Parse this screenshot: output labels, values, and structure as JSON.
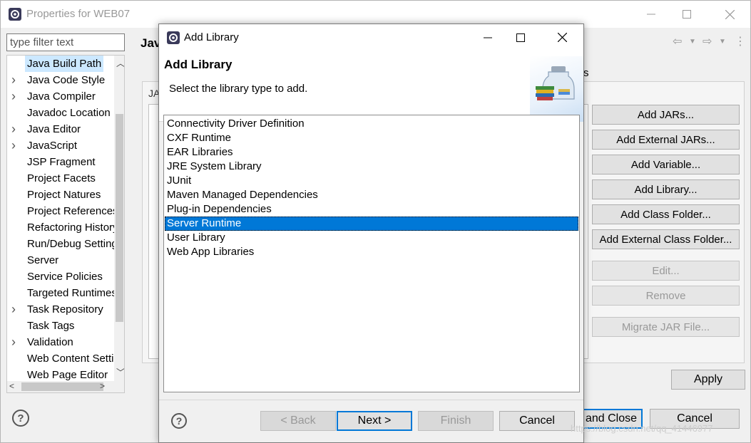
{
  "outer_window": {
    "title": "Properties for WEB07",
    "filter_placeholder": "type filter text",
    "page_heading": "Jav",
    "tree_items": [
      {
        "label": "Java Build Path",
        "has_arrow": false,
        "selected": true
      },
      {
        "label": "Java Code Style",
        "has_arrow": true,
        "selected": false
      },
      {
        "label": "Java Compiler",
        "has_arrow": true,
        "selected": false
      },
      {
        "label": "Javadoc Location",
        "has_arrow": false,
        "selected": false
      },
      {
        "label": "Java Editor",
        "has_arrow": true,
        "selected": false
      },
      {
        "label": "JavaScript",
        "has_arrow": true,
        "selected": false
      },
      {
        "label": "JSP Fragment",
        "has_arrow": false,
        "selected": false
      },
      {
        "label": "Project Facets",
        "has_arrow": false,
        "selected": false
      },
      {
        "label": "Project Natures",
        "has_arrow": false,
        "selected": false
      },
      {
        "label": "Project References",
        "has_arrow": false,
        "selected": false
      },
      {
        "label": "Refactoring History",
        "has_arrow": false,
        "selected": false
      },
      {
        "label": "Run/Debug Settings",
        "has_arrow": false,
        "selected": false
      },
      {
        "label": "Server",
        "has_arrow": false,
        "selected": false
      },
      {
        "label": "Service Policies",
        "has_arrow": false,
        "selected": false
      },
      {
        "label": "Targeted Runtimes",
        "has_arrow": false,
        "selected": false
      },
      {
        "label": "Task Repository",
        "has_arrow": true,
        "selected": false
      },
      {
        "label": "Task Tags",
        "has_arrow": false,
        "selected": false
      },
      {
        "label": "Validation",
        "has_arrow": true,
        "selected": false
      },
      {
        "label": "Web Content Settings",
        "has_arrow": false,
        "selected": false
      },
      {
        "label": "Web Page Editor",
        "has_arrow": false,
        "selected": false
      }
    ],
    "side_buttons": [
      {
        "label": "Add JARs...",
        "enabled": true
      },
      {
        "label": "Add External JARs...",
        "enabled": true
      },
      {
        "label": "Add Variable...",
        "enabled": true
      },
      {
        "label": "Add Library...",
        "enabled": true
      },
      {
        "label": "Add Class Folder...",
        "enabled": true
      },
      {
        "label": "Add External Class Folder...",
        "enabled": true
      },
      {
        "label": "Edit...",
        "enabled": false
      },
      {
        "label": "Remove",
        "enabled": false
      },
      {
        "label": "Migrate JAR File...",
        "enabled": false
      }
    ],
    "apply_label": "Apply",
    "apply_close_label": "y and Close",
    "cancel_label": "Cancel",
    "partial_tab_text": "s",
    "partial_label": "JA"
  },
  "dialog": {
    "title": "Add Library",
    "heading": "Add Library",
    "description": "Select the library type to add.",
    "libraries": [
      "Connectivity Driver Definition",
      "CXF Runtime",
      "EAR Libraries",
      "JRE System Library",
      "JUnit",
      "Maven Managed Dependencies",
      "Plug-in Dependencies",
      "Server Runtime",
      "User Library",
      "Web App Libraries"
    ],
    "selected_index": 7,
    "buttons": {
      "back": "< Back",
      "next": "Next >",
      "finish": "Finish",
      "cancel": "Cancel"
    }
  },
  "watermark": "https://blog.csdn.net/qq_41446977",
  "colors": {
    "selection": "#0078d7",
    "tree_selection": "#cce8ff"
  }
}
